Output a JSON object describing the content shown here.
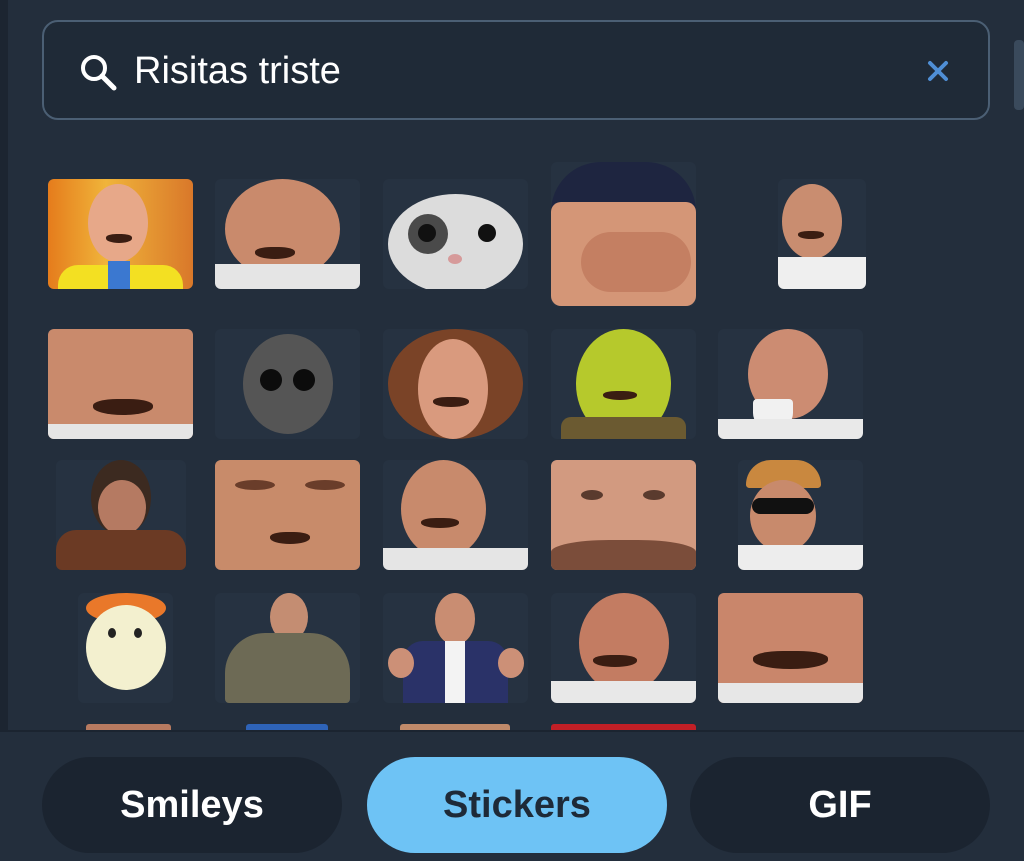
{
  "search": {
    "value": "Risitas triste",
    "icon": "search-icon",
    "clear_icon": "close-icon"
  },
  "stickers": [
    {
      "name": "sticker-risitas-tv-studio"
    },
    {
      "name": "sticker-risitas-laughing-side"
    },
    {
      "name": "sticker-cat-staring"
    },
    {
      "name": "sticker-risitas-beanie-facepalm"
    },
    {
      "name": "sticker-risitas-small-portrait"
    },
    {
      "name": "sticker-risitas-closeup-downcast"
    },
    {
      "name": "sticker-sad-wojak-dark"
    },
    {
      "name": "sticker-risitas-curly-hair"
    },
    {
      "name": "sticker-risitas-shrek"
    },
    {
      "name": "sticker-risitas-cup"
    },
    {
      "name": "sticker-man-crying-hand"
    },
    {
      "name": "sticker-risitas-face-stretched"
    },
    {
      "name": "sticker-risitas-grin"
    },
    {
      "name": "sticker-risitas-bald-closeup"
    },
    {
      "name": "sticker-risitas-sunglasses-bandana"
    },
    {
      "name": "sticker-hamtaro-sad"
    },
    {
      "name": "sticker-risitas-hands-on-hips"
    },
    {
      "name": "sticker-risitas-suit-hands-up"
    },
    {
      "name": "sticker-risitas-frown"
    },
    {
      "name": "sticker-risitas-crying-closeup"
    }
  ],
  "tabs": [
    {
      "label": "Smileys",
      "active": false
    },
    {
      "label": "Stickers",
      "active": true
    },
    {
      "label": "GIF",
      "active": false
    }
  ],
  "colors": {
    "background": "#232e3c",
    "active_tab": "#6ec3f5",
    "inactive_tab": "#1b2430",
    "clear_icon": "#4f8fd6"
  }
}
